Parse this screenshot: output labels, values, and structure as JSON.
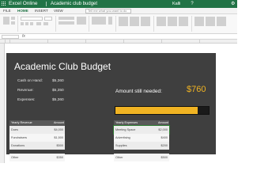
{
  "titlebar": {
    "app_name": "Excel Online",
    "file_name": "Academic club budget",
    "user_name": "Kalli"
  },
  "ribbon": {
    "tabs": [
      {
        "label": "FILE",
        "active": false
      },
      {
        "label": "HOME",
        "active": true
      },
      {
        "label": "INSERT",
        "active": false
      },
      {
        "label": "VIEW",
        "active": false
      }
    ],
    "search_placeholder": "Tell me what you want to do"
  },
  "banner": {
    "title": "Academic Club Budget",
    "summary": [
      {
        "label": "Cash on Hand:",
        "value": "$5,360"
      },
      {
        "label": "Revenue:",
        "value": "$5,350"
      },
      {
        "label": "Expenses:",
        "value": "$5,360"
      }
    ],
    "amount_needed_label": "Amount still needed:",
    "amount_needed_value": "$760",
    "progress_fraction": 0.88
  },
  "revenue_table": {
    "headers": [
      "Yearly Revenue",
      "Amount"
    ],
    "rows": [
      {
        "name": "Dues",
        "amount": "$4,000"
      },
      {
        "name": "Fundraisers",
        "amount": "$1,500"
      },
      {
        "name": "Donations",
        "amount": "$500"
      },
      {
        "name": "Other",
        "amount": "$350"
      }
    ]
  },
  "expenses_table": {
    "headers": [
      "Yearly Expenses",
      "Amount"
    ],
    "rows": [
      {
        "name": "Meeting Space",
        "amount": "$2,000"
      },
      {
        "name": "Advertising",
        "amount": "$400"
      },
      {
        "name": "Supplies",
        "amount": "$200"
      },
      {
        "name": "Other",
        "amount": "$500"
      }
    ]
  },
  "colors": {
    "brand": "#217346",
    "banner": "#3f3f3f",
    "accent": "#f0b323"
  }
}
